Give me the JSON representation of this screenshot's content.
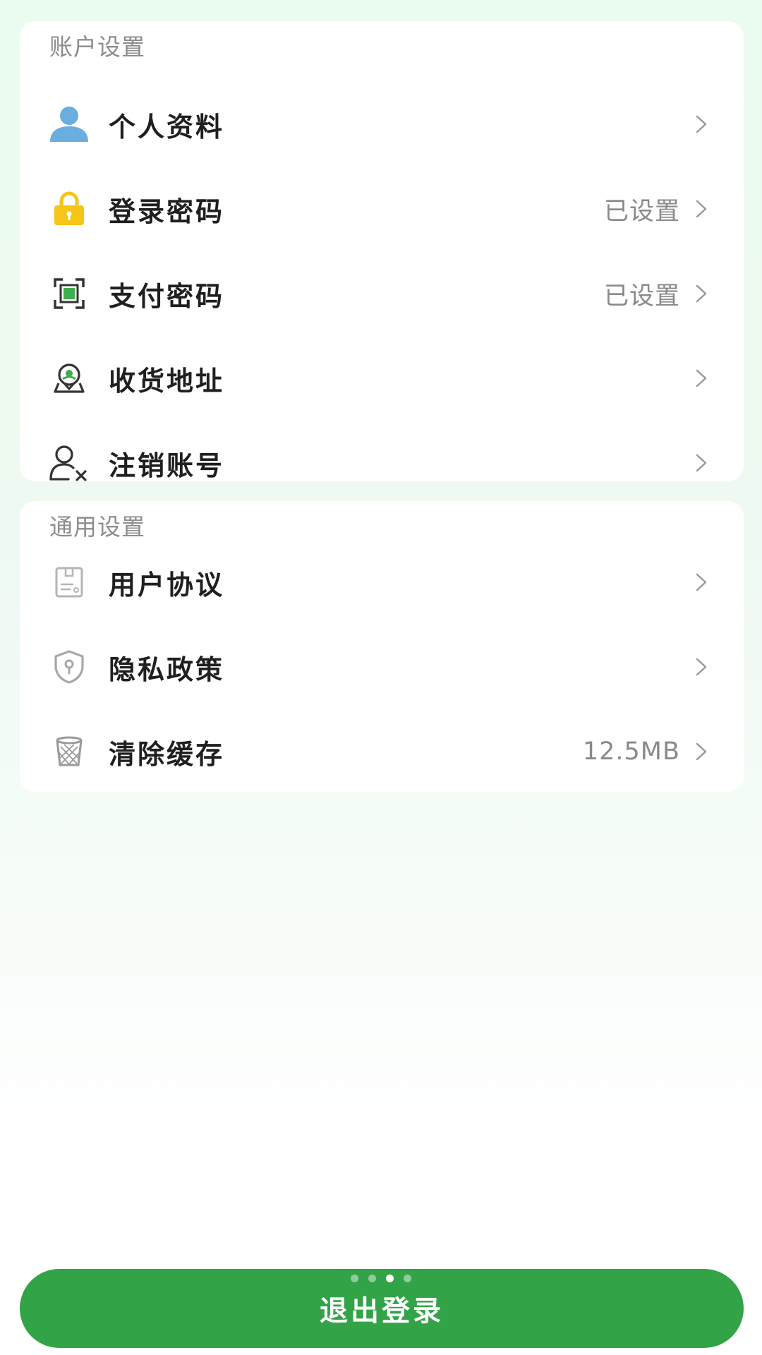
{
  "account_section": {
    "title": "账户设置",
    "items": [
      {
        "label": "个人资料",
        "value": "",
        "icon": "user-icon"
      },
      {
        "label": "登录密码",
        "value": "已设置",
        "icon": "lock-icon"
      },
      {
        "label": "支付密码",
        "value": "已设置",
        "icon": "scan-frame-icon"
      },
      {
        "label": "收货地址",
        "value": "",
        "icon": "location-pin-icon"
      },
      {
        "label": "注销账号",
        "value": "",
        "icon": "user-remove-icon"
      }
    ]
  },
  "general_section": {
    "title": "通用设置",
    "items": [
      {
        "label": "用户协议",
        "value": "",
        "icon": "document-icon"
      },
      {
        "label": "隐私政策",
        "value": "",
        "icon": "shield-icon"
      },
      {
        "label": "清除缓存",
        "value": "12.5MB",
        "icon": "trash-icon"
      }
    ]
  },
  "logout": {
    "label": "退出登录"
  },
  "page_indicator": {
    "count": 4,
    "active_index": 2
  },
  "colors": {
    "accent_green": "#33a347",
    "lock_yellow": "#f5c518",
    "user_blue": "#6aaee0",
    "icon_gray": "#9a9a9a"
  }
}
